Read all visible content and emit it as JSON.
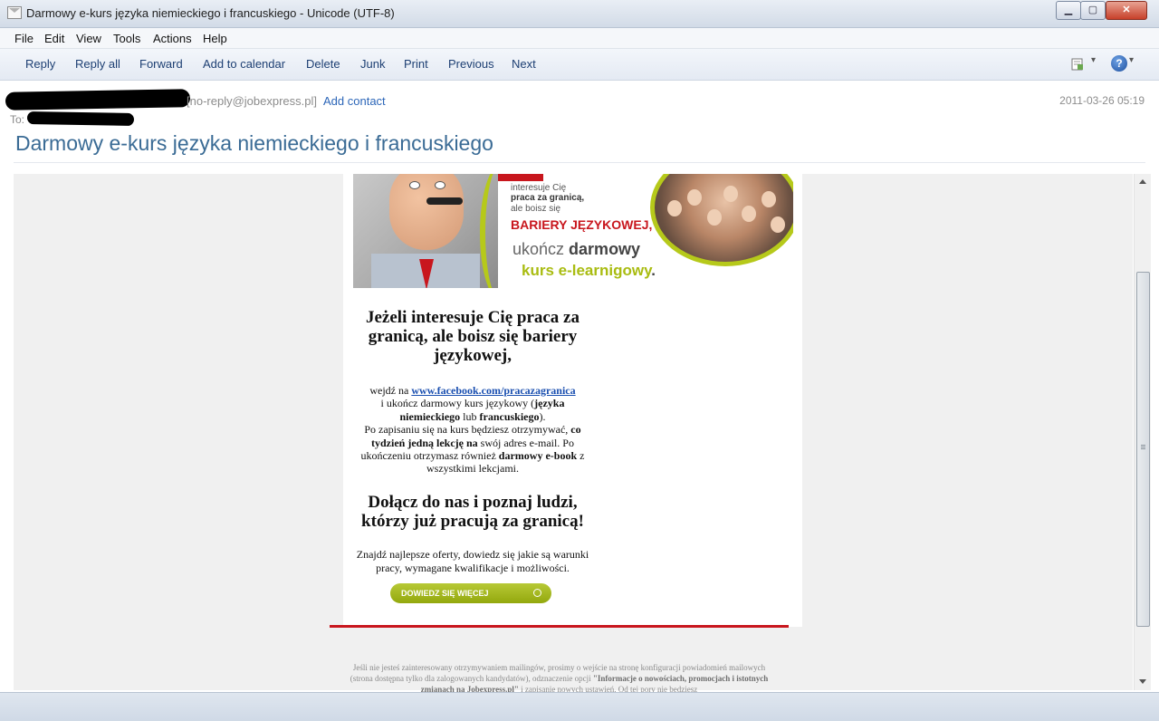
{
  "window": {
    "title": "Darmowy e-kurs języka niemieckiego i francuskiego - Unicode (UTF-8)",
    "min_glyph": "▁",
    "max_glyph": "▢",
    "close_glyph": "✕"
  },
  "menu": {
    "file": "File",
    "edit": "Edit",
    "view": "View",
    "tools": "Tools",
    "actions": "Actions",
    "help": "Help"
  },
  "toolbar": {
    "reply": "Reply",
    "reply_all": "Reply all",
    "forward": "Forward",
    "add_to_calendar": "Add to calendar",
    "delete": "Delete",
    "junk": "Junk",
    "print": "Print",
    "previous": "Previous",
    "next": "Next",
    "help_glyph": "?",
    "dropdown_glyph": "▾"
  },
  "header": {
    "from_email": "[no-reply@jobexpress.pl]",
    "add_contact": "Add contact",
    "date": "2011-03-26 05:19",
    "to_label": "To:",
    "subject": "Darmowy e-kurs języka niemieckiego i francuskiego"
  },
  "banner": {
    "line1": "interesuje Cię",
    "line2": "praca za granicą,",
    "line3": "ale boisz się",
    "line4": "BARIERY JĘZYKOWEJ,",
    "line5_a": "ukończ ",
    "line5_b": "darmowy",
    "line6_a": "kurs e-learnigowy",
    "line6_b": "."
  },
  "body": {
    "heading1": "Jeżeli interesuje Cię praca za granicą, ale boisz się bariery językowej,",
    "p1_a": "wejdź na ",
    "p1_link": "www.facebook.com/pracazagranica",
    "p1_b": "i ukończ darmowy kurs językowy (",
    "p1_c": "języka niemieckiego",
    "p1_d": " lub ",
    "p1_e": "francuskiego",
    "p1_f": ").",
    "p1_g": "Po zapisaniu się na kurs będziesz otrzymywać, ",
    "p1_h": "co tydzień jedną lekcję na",
    "p1_i": " swój adres e-mail. Po ukończeniu otrzymasz również ",
    "p1_j": "darmowy e-book",
    "p1_k": " z wszystkimi lekcjami.",
    "heading2": "Dołącz do nas i poznaj ludzi, którzy już pracują za granicą!",
    "p2": "Znajdź najlepsze oferty, dowiedz się jakie są warunki pracy, wymagane kwalifikacje i możliwości.",
    "cta": "DOWIEDZ SIĘ WIĘCEJ"
  },
  "footer": {
    "text_a": "Jeśli nie jesteś zainteresowany otrzymywaniem mailingów, prosimy o wejście na stronę konfiguracji powiadomień mailowych (strona dostępna tylko dla zalogowanych kandydatów), odznaczenie opcji ",
    "text_b": "\"Informacje o nowościach, promocjach i istotnych zmianach na Jobexpress.pl\"",
    "text_c": " i zapisanie nowych ustawień. Od tej pory nie będziesz"
  },
  "colors": {
    "accent": "#3a6b95",
    "link": "#2c66b8",
    "brand_red": "#c8161d",
    "brand_green": "#b6c91a"
  }
}
